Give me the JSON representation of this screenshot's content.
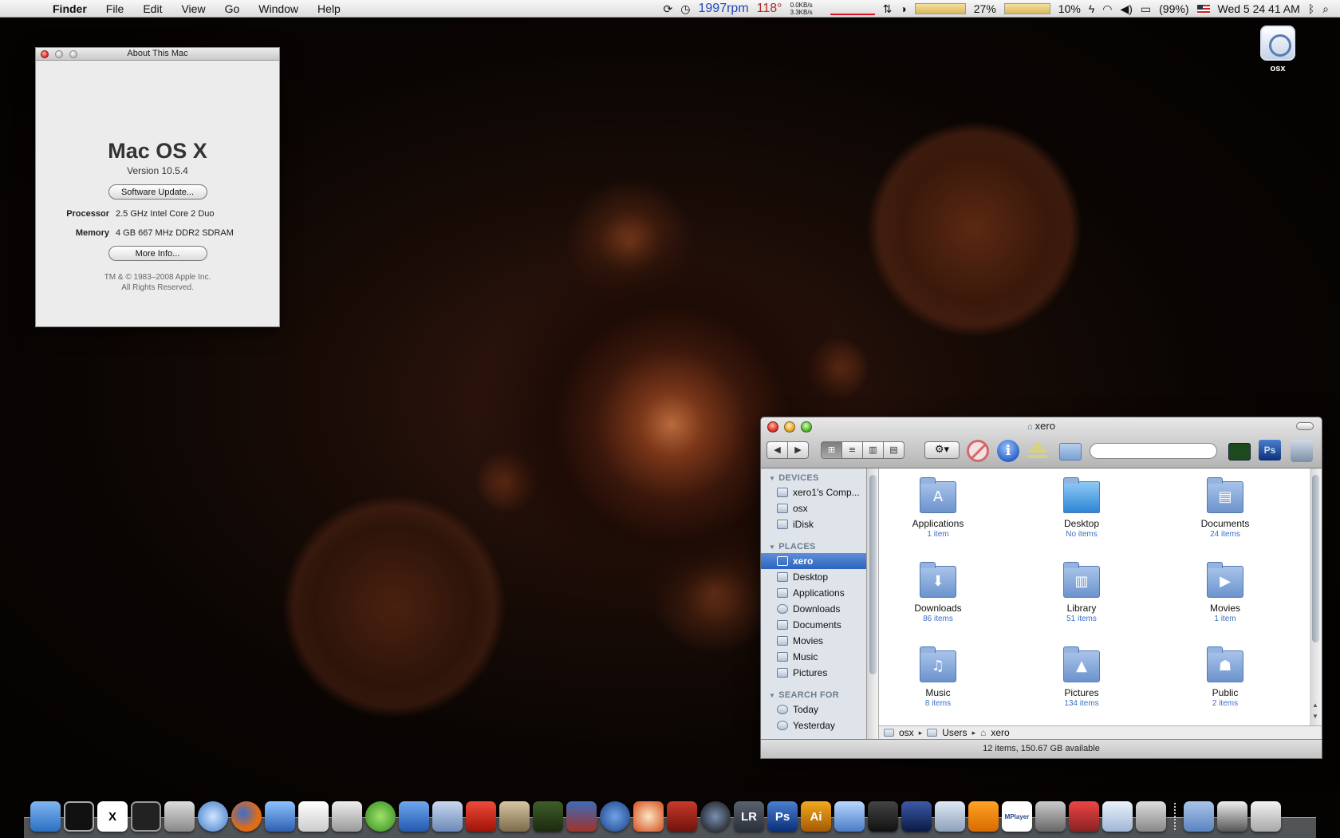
{
  "menubar": {
    "apple": "",
    "items": [
      "Finder",
      "File",
      "Edit",
      "View",
      "Go",
      "Window",
      "Help"
    ],
    "status": {
      "fan": "1997rpm",
      "temp": "118°",
      "net_up": "0.0KB/s",
      "net_down": "3.3KB/s",
      "cpu": "27%",
      "mem": "10%",
      "battery": "(99%)",
      "clock": "Wed 5 24 41 AM"
    }
  },
  "about": {
    "title": "About This Mac",
    "os_name": "Mac OS X",
    "version": "Version 10.5.4",
    "software_update": "Software Update...",
    "processor_label": "Processor",
    "processor_value": "2.5 GHz Intel Core 2 Duo",
    "memory_label": "Memory",
    "memory_value": "4 GB 667 MHz DDR2 SDRAM",
    "more_info": "More Info...",
    "copyright1": "TM & © 1983–2008 Apple Inc.",
    "copyright2": "All Rights Reserved."
  },
  "desktop": {
    "drive_label": "osx"
  },
  "finder": {
    "title": "xero",
    "search_placeholder": "",
    "ps_icon": "Ps",
    "sidebar": {
      "devices_header": "DEVICES",
      "devices": [
        "xero1's Comp...",
        "osx",
        "iDisk"
      ],
      "places_header": "PLACES",
      "places": [
        "xero",
        "Desktop",
        "Applications",
        "Downloads",
        "Documents",
        "Movies",
        "Music",
        "Pictures"
      ],
      "search_header": "SEARCH FOR",
      "search": [
        "Today",
        "Yesterday"
      ]
    },
    "items": [
      {
        "name": "Applications",
        "count": "1 item"
      },
      {
        "name": "Desktop",
        "count": "No items"
      },
      {
        "name": "Documents",
        "count": "24 items"
      },
      {
        "name": "Downloads",
        "count": "86 items"
      },
      {
        "name": "Library",
        "count": "51 items"
      },
      {
        "name": "Movies",
        "count": "1 item"
      },
      {
        "name": "Music",
        "count": "8 items"
      },
      {
        "name": "Pictures",
        "count": "134 items"
      },
      {
        "name": "Public",
        "count": "2 items"
      }
    ],
    "path": [
      "osx",
      "Users",
      "xero"
    ],
    "status": "12 items, 150.67 GB available"
  },
  "dock": {
    "labels": {
      "lr": "LR",
      "ps": "Ps",
      "ai": "Ai",
      "x": "X",
      "mplayer": "MPlayer"
    }
  },
  "colors": {
    "selection": "#3a6fc6",
    "menubar": "#e8e8e8",
    "sidebar": "#dee4ea"
  }
}
